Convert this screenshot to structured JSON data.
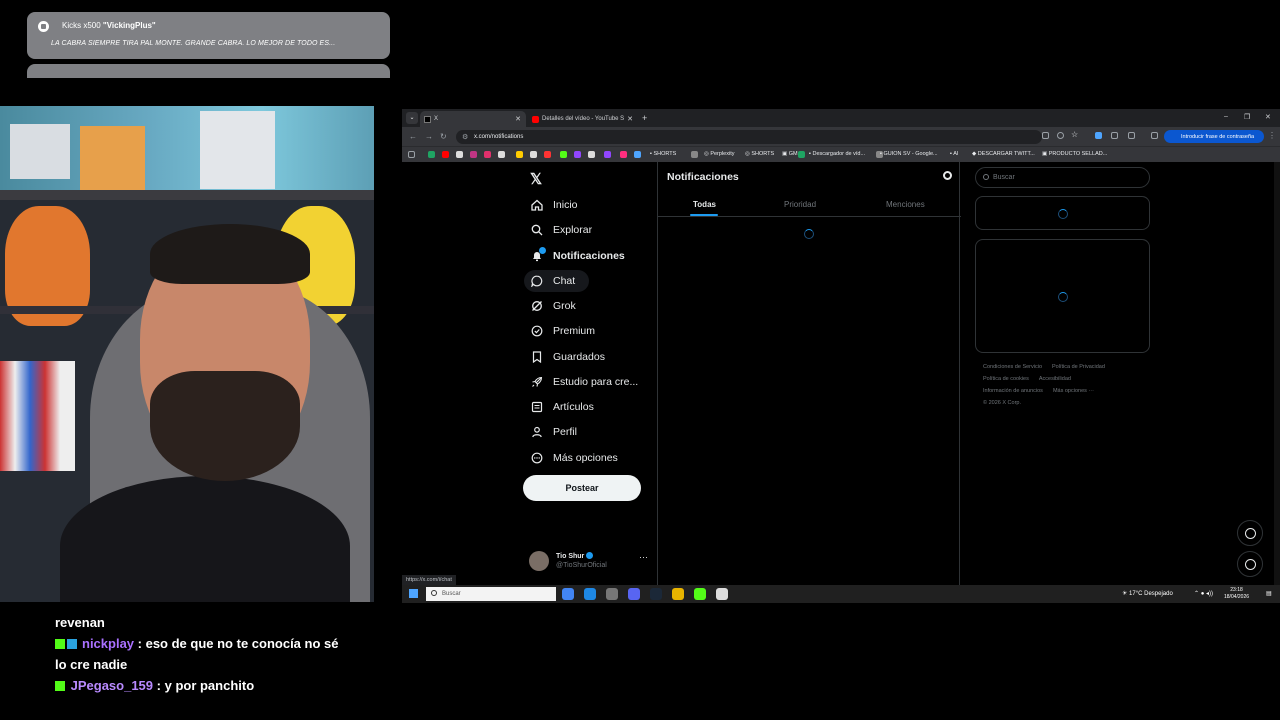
{
  "alert": {
    "count_label": "Kicks x500",
    "user": "\"VickingPlus\"",
    "message": "LA CABRA SIEMPRE TIRA PAL MONTE. GRANDE CABRA. LO MEJOR DE TODO ES..."
  },
  "chat": {
    "cut_text": "revenan",
    "messages": [
      {
        "user": "nickplay",
        "text": ": eso de que no te conocía no sé lo cre nadie"
      },
      {
        "user": "JPegaso_159",
        "text": ": y por panchito"
      }
    ]
  },
  "browser": {
    "tabs": [
      {
        "title": "X"
      },
      {
        "title": "Detalles del vídeo - YouTube S"
      }
    ],
    "url": "x.com/notifications",
    "password_button": "Introducir frase de contraseña",
    "bookmarks": [
      "SHORTS",
      "Perplexity",
      "SHORTS",
      "GM",
      "Descargador de víd...",
      "GUION SV - Google...",
      "AI",
      "DESCARGAR TWITT...",
      "PRODUCTO SELLAD..."
    ],
    "status_url": "https://x.com/i/chat"
  },
  "x": {
    "nav": [
      {
        "label": "Inicio",
        "icon": "home-icon"
      },
      {
        "label": "Explorar",
        "icon": "search-icon"
      },
      {
        "label": "Notificaciones",
        "icon": "bell-icon"
      },
      {
        "label": "Chat",
        "icon": "chat-icon"
      },
      {
        "label": "Grok",
        "icon": "grok-icon"
      },
      {
        "label": "Premium",
        "icon": "premium-icon"
      },
      {
        "label": "Guardados",
        "icon": "bookmark-icon"
      },
      {
        "label": "Estudio para cre...",
        "icon": "rocket-icon"
      },
      {
        "label": "Artículos",
        "icon": "article-icon"
      },
      {
        "label": "Perfil",
        "icon": "person-icon"
      },
      {
        "label": "Más opciones",
        "icon": "more-icon"
      }
    ],
    "post_button": "Postear",
    "profile": {
      "name": "Tio Shur",
      "handle": "@TioShurOficial"
    },
    "column_title": "Notificaciones",
    "tabs": [
      "Todas",
      "Prioridad",
      "Menciones"
    ],
    "search_placeholder": "Buscar",
    "footer": {
      "links": [
        "Condiciones de Servicio",
        "Política de Privacidad",
        "Política de cookies",
        "Accesibilidad",
        "Información de anuncios",
        "Más opciones ···"
      ],
      "copyright": "© 2026 X Corp."
    }
  },
  "taskbar": {
    "search_placeholder": "Buscar",
    "weather": "17°C  Despejado",
    "time": "23:18",
    "date": "18/04/2026"
  }
}
